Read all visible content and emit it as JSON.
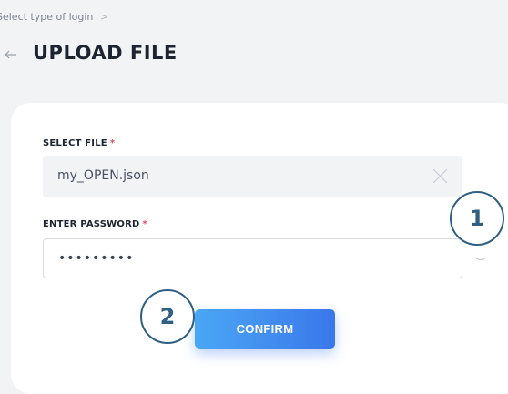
{
  "breadcrumb": {
    "text": "Select type of login",
    "separator": ">"
  },
  "header": {
    "title": "UPLOAD FILE",
    "back_icon": "arrow-left-icon"
  },
  "form": {
    "file_label": "SELECT FILE",
    "password_label": "ENTER PASSWORD",
    "required_mark": "*",
    "file_value": "my_OPEN.json",
    "password_value": "•••••••••",
    "clear_icon": "close-icon",
    "confirm_label": "CONFIRM"
  },
  "badges": {
    "step1": "1",
    "step2": "2"
  },
  "colors": {
    "accent_start": "#4aa7f5",
    "accent_end": "#3a77ea",
    "required": "#e2495b",
    "badge_border": "#2f5f82"
  }
}
